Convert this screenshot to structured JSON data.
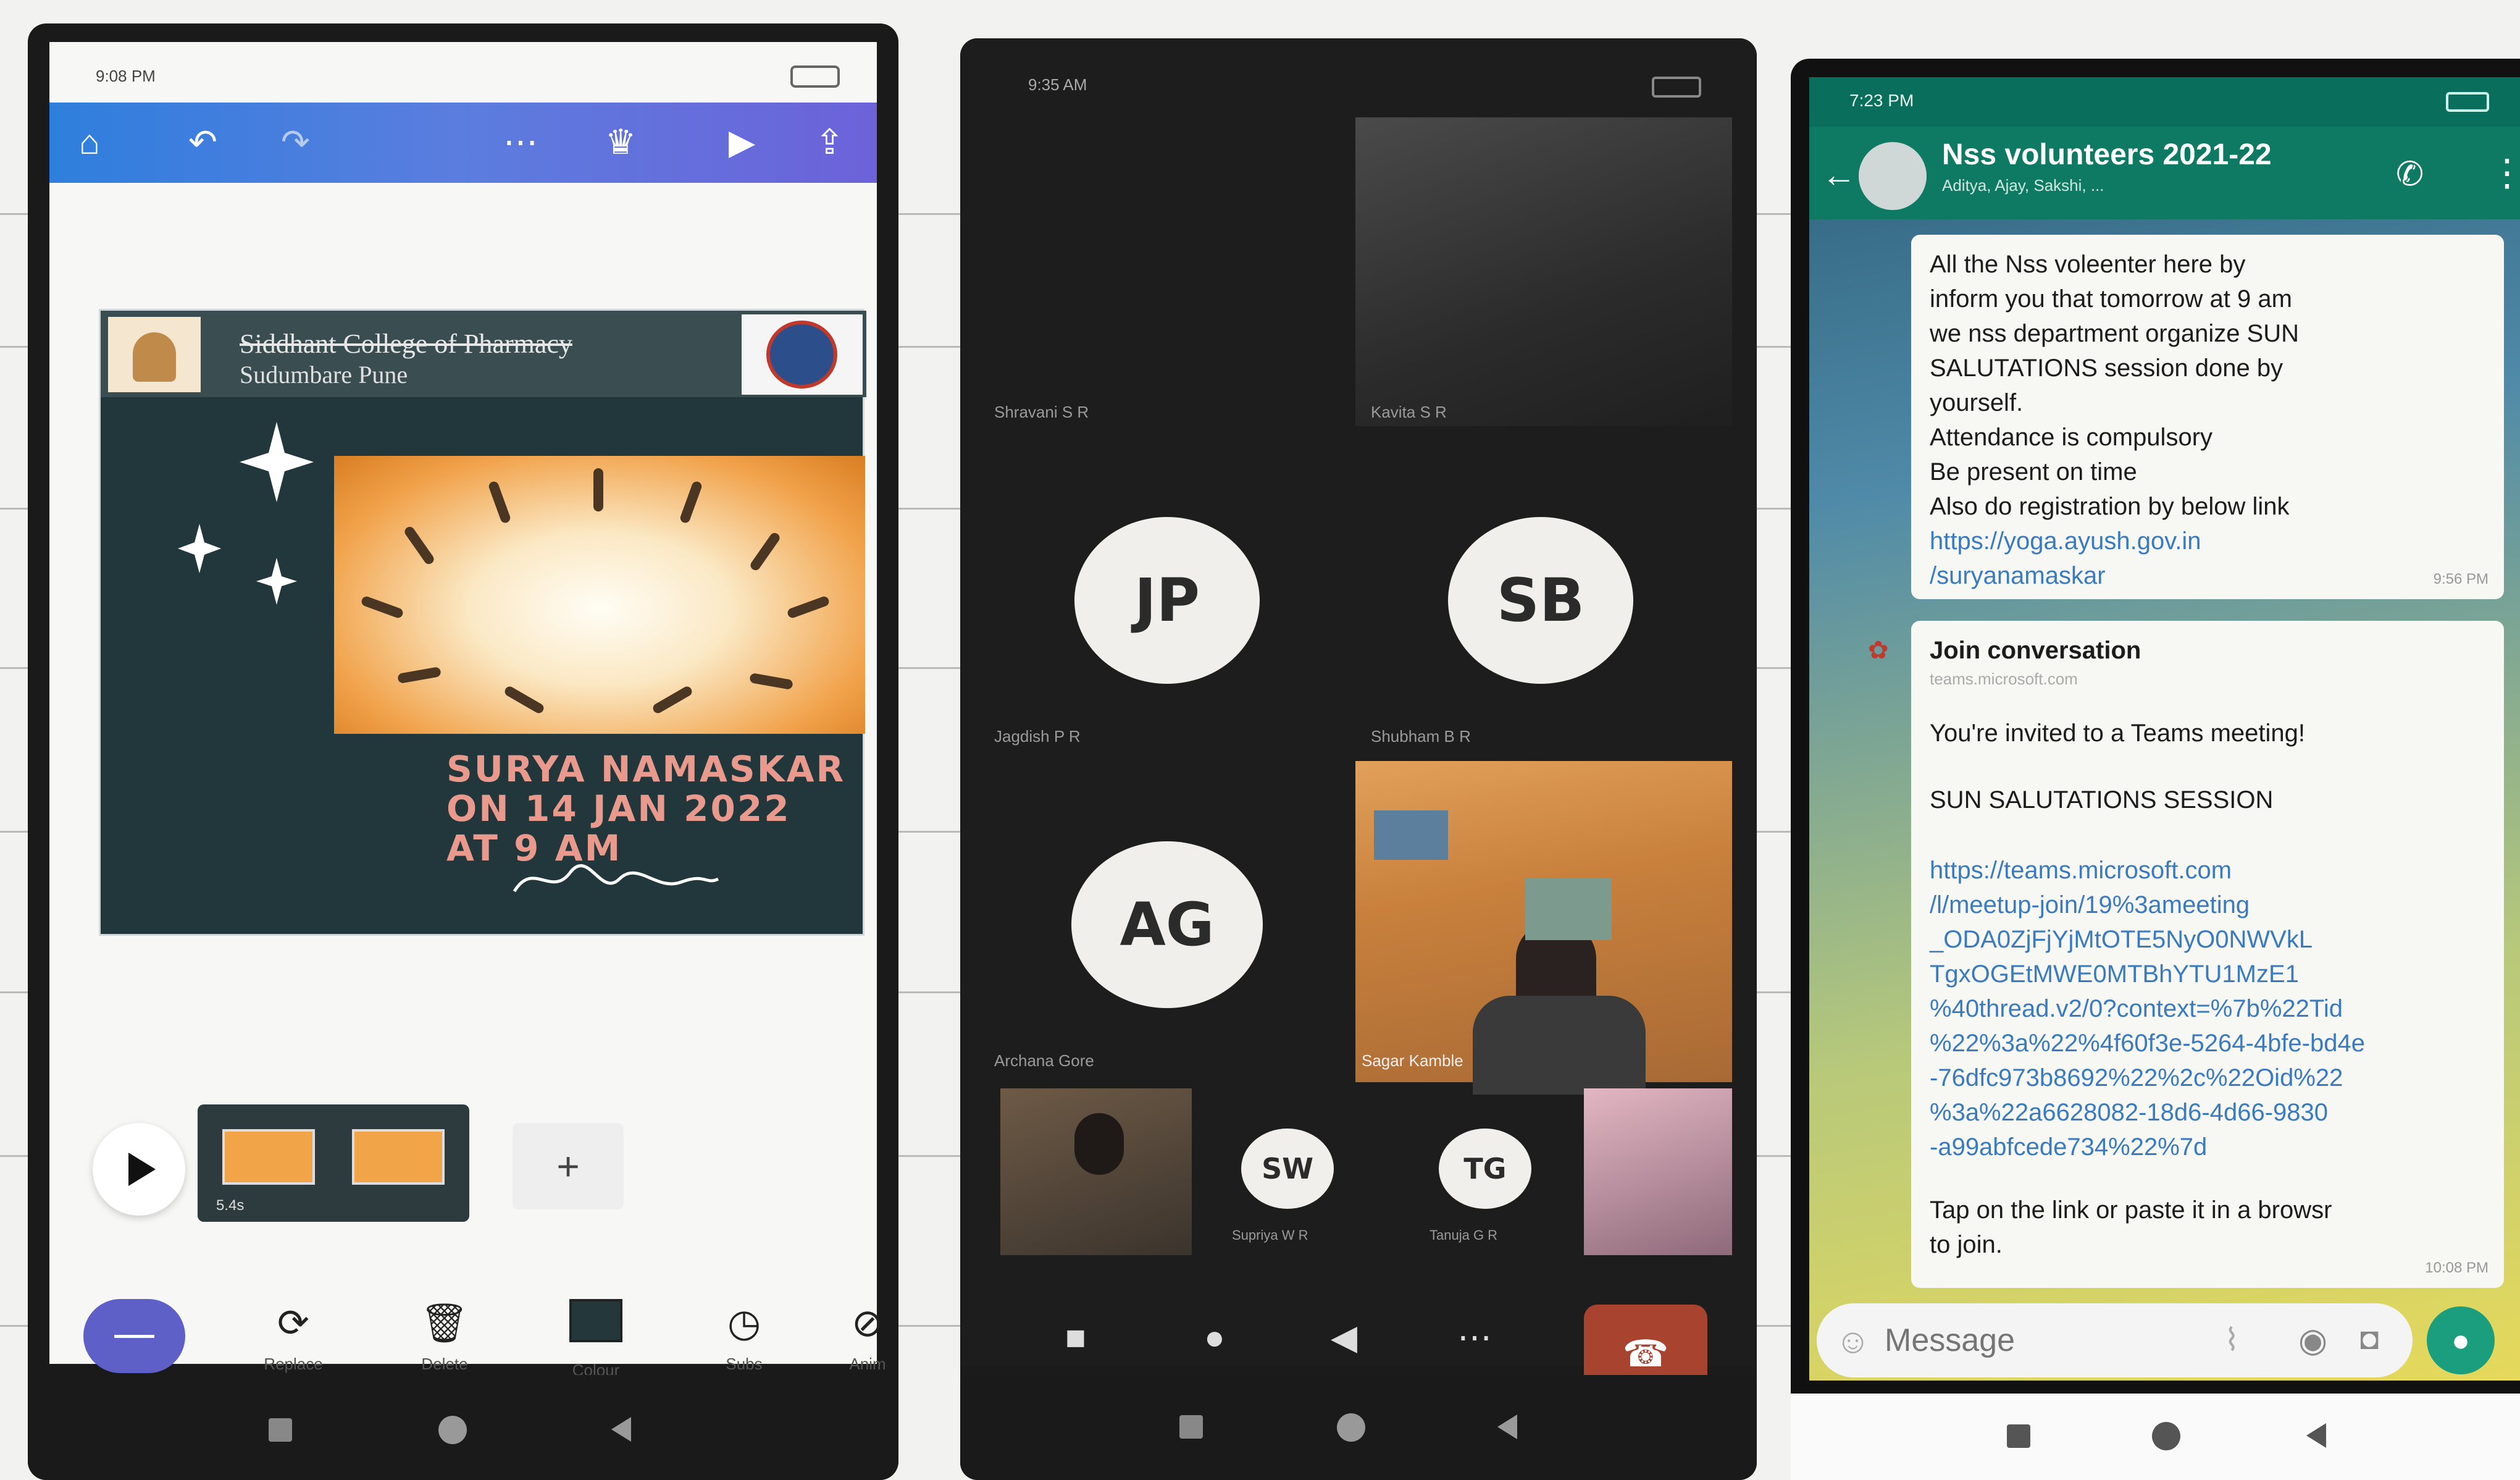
{
  "phone1": {
    "status_time": "9:08 PM",
    "toolbar_icons": [
      "home-icon",
      "undo-icon",
      "redo-icon",
      "more-icon",
      "crown-icon",
      "play-icon",
      "share-icon"
    ],
    "slide": {
      "college_line1": "Siddhant College of Pharmacy",
      "college_line2": "Sudumbare Pune",
      "headline": [
        "SURYA NAMASKAR",
        "ON 14 JAN 2022",
        "AT 9 AM"
      ]
    },
    "clip_duration": "5.4s",
    "tools": [
      {
        "label": "Replace",
        "icon": "replace-icon"
      },
      {
        "label": "Delete",
        "icon": "delete-icon"
      },
      {
        "label": "Colour",
        "icon": "colour-icon"
      },
      {
        "label": "Subs",
        "icon": "clock-icon"
      },
      {
        "label": "Anim",
        "icon": "anim-icon"
      }
    ]
  },
  "phone2": {
    "status_time": "9:35 AM",
    "participants": [
      {
        "name": "Shravani S R",
        "initials": ""
      },
      {
        "name": "Kavita S R",
        "initials": ""
      },
      {
        "name": "Jagdish P R",
        "initials": "JP"
      },
      {
        "name": "Shubham B R",
        "initials": "SB"
      },
      {
        "name": "Archana Gore",
        "initials": "AG"
      },
      {
        "name": "Sagar Kamble",
        "initials": ""
      },
      {
        "name": "Supriya W R",
        "initials": "SW"
      },
      {
        "name": "Tanuja G R",
        "initials": "TG"
      }
    ]
  },
  "phone3": {
    "status_time": "7:23 PM",
    "chat_title": "Nss volunteers 2021-22",
    "chat_subtitle": "Aditya, Ajay, Sakshi, ...",
    "message1": [
      "All the Nss voleenter here by",
      "inform you that tomorrow at 9 am",
      "we nss department organize SUN",
      "SALUTATIONS session done by",
      "yourself.",
      "Attendance is compulsory",
      "Be present on time",
      "Also do registration by below link"
    ],
    "message1_link": [
      "https://yoga.ayush.gov.in",
      "/suryanamaskar"
    ],
    "message1_time": "9:56 PM",
    "join_title": "Join conversation",
    "join_domain": "teams.microsoft.com",
    "invite_text": "You're invited to a Teams meeting!",
    "session_title": "SUN SALUTATIONS SESSION",
    "teams_link": [
      "https://teams.microsoft.com",
      "/l/meetup-join/19%3ameeting",
      "_ODA0ZjFjYjMtOTE5NyO0NWVkL",
      "TgxOGEtMWE0MTBhYTU1MzE1",
      "%40thread.v2/0?context=%7b%22Tid",
      "%22%3a%22%4f60f3e-5264-4bfe-bd4e",
      "-76dfc973b8692%22%2c%22Oid%22",
      "%3a%22a6628082-18d6-4d66-9830",
      "-a99abfcede734%22%7d"
    ],
    "tap_text": [
      "Tap on the link or paste it in a browsr",
      "to join."
    ],
    "message2_time": "10:08 PM",
    "input_placeholder": "Message"
  }
}
